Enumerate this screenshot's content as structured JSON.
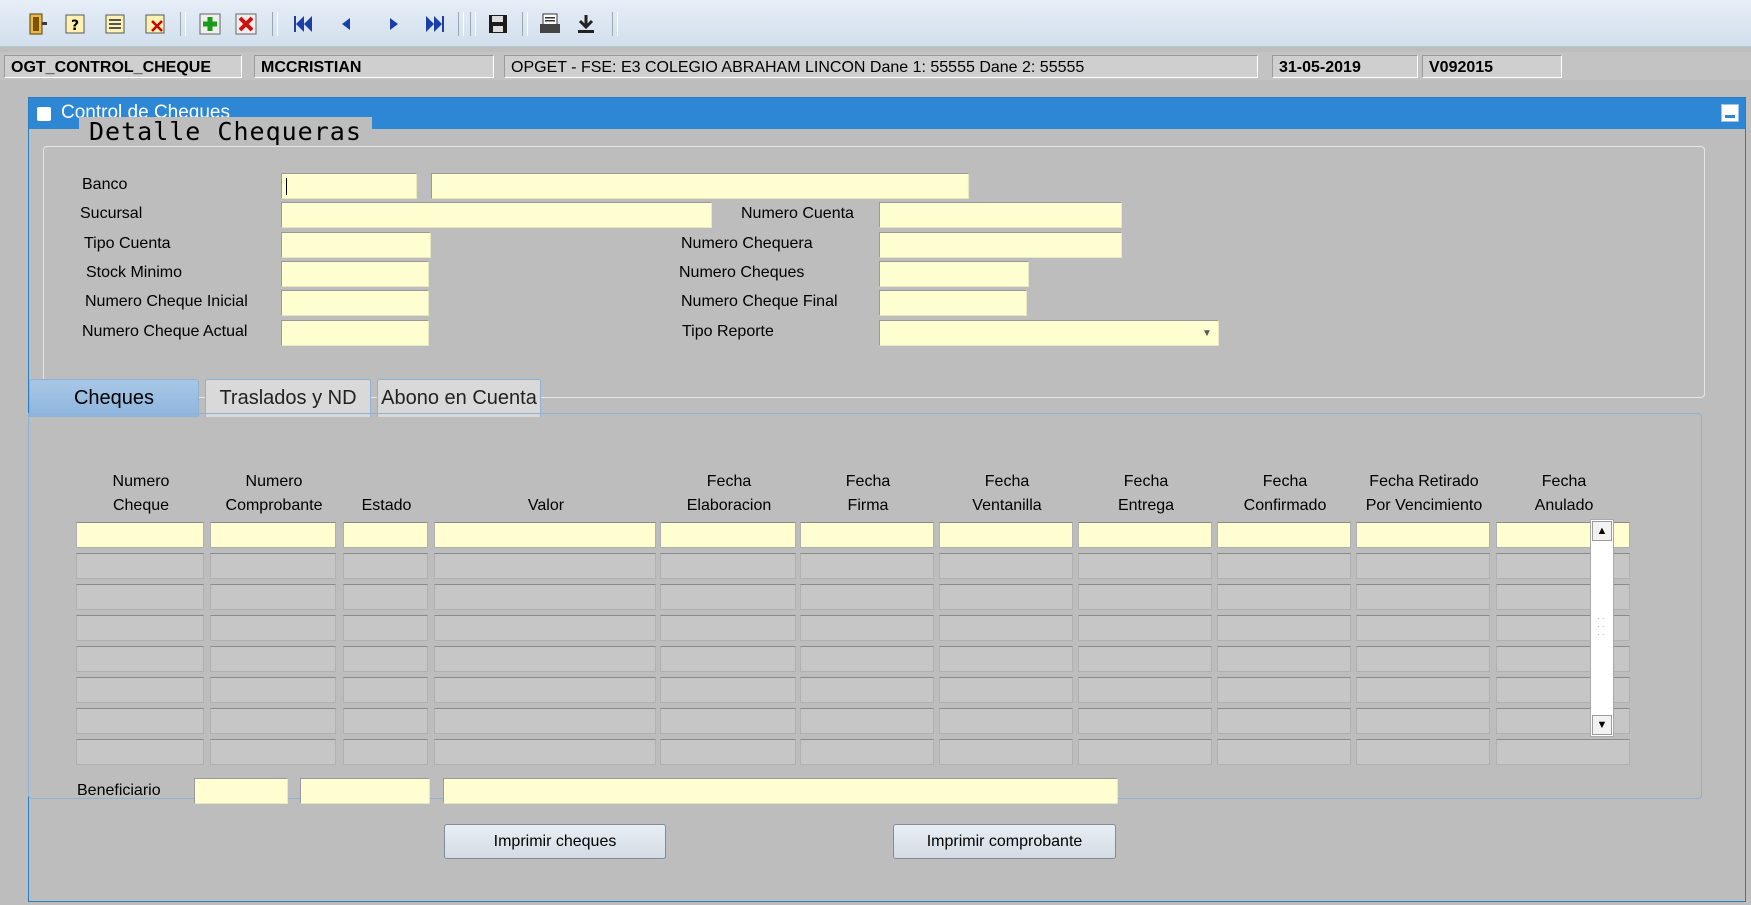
{
  "toolbar": {
    "icons": [
      "exit-icon",
      "query-icon",
      "query-all-icon",
      "clear-icon",
      "insert-record-icon",
      "delete-record-icon",
      "first-record-icon",
      "previous-record-icon",
      "next-record-icon",
      "last-record-icon",
      "save-icon",
      "print-icon",
      "download-icon"
    ]
  },
  "status": {
    "form_name": "OGT_CONTROL_CHEQUE",
    "user": "MCCRISTIAN",
    "context": "OPGET - FSE: E3 COLEGIO ABRAHAM LINCON  Dane 1: 55555  Dane 2: 55555",
    "date": "31-05-2019",
    "version": "V092015"
  },
  "window": {
    "title": "Control de Cheques"
  },
  "detalle": {
    "title": "Detalle Chequeras",
    "labels": {
      "banco": "Banco",
      "sucursal": "Sucursal",
      "tipo_cuenta": "Tipo Cuenta",
      "stock_minimo": "Stock Minimo",
      "cheque_inicial": "Numero Cheque Inicial",
      "cheque_actual": "Numero Cheque Actual",
      "numero_cuenta": "Numero Cuenta",
      "numero_chequera": "Numero Chequera",
      "numero_cheques": "Numero Cheques",
      "cheque_final": "Numero Cheque Final",
      "tipo_reporte": "Tipo Reporte"
    }
  },
  "tabs": [
    "Cheques",
    "Traslados y ND",
    "Abono en Cuenta"
  ],
  "grid": {
    "headers": [
      [
        "Numero",
        "Cheque"
      ],
      [
        "Numero",
        "Comprobante"
      ],
      [
        "",
        "Estado"
      ],
      [
        "",
        "Valor"
      ],
      [
        "Fecha",
        "Elaboracion"
      ],
      [
        "Fecha",
        "Firma"
      ],
      [
        "Fecha",
        "Ventanilla"
      ],
      [
        "Fecha",
        "Entrega"
      ],
      [
        "Fecha",
        "Confirmado"
      ],
      [
        "Fecha Retirado",
        "Por Vencimiento"
      ],
      [
        "Fecha",
        "Anulado"
      ]
    ]
  },
  "beneficiario": {
    "label": "Beneficiario"
  },
  "buttons": {
    "imprimir_cheques": "Imprimir cheques",
    "imprimir_comprobante": "Imprimir comprobante"
  },
  "colors": {
    "accent": "#2e87d4",
    "field": "#fffed0",
    "background": "#bdbdbd"
  }
}
